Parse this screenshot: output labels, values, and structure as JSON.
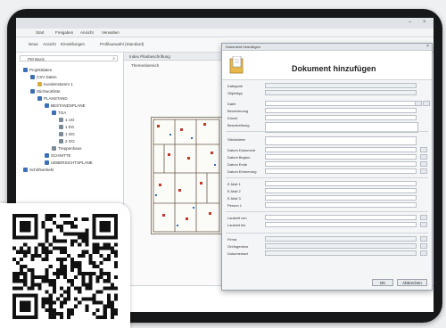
{
  "window": {
    "title": ""
  },
  "menu": {
    "items": [
      "Start",
      "Freigaben",
      "Ansicht",
      "Verwalten"
    ]
  },
  "toolbar": {
    "items": [
      "Neue",
      "Ansicht",
      "Einstellungen",
      "Profilauswahl (Standard)"
    ]
  },
  "tree": {
    "search_placeholder": "PM Basis",
    "items": [
      {
        "label": "Projektdaten",
        "level": 0,
        "color": "blue"
      },
      {
        "label": "CSV Daten",
        "level": 1,
        "color": "blue"
      },
      {
        "label": "Kundenstamm 1",
        "level": 2,
        "color": "yellow"
      },
      {
        "label": "Stichwortliste",
        "level": 1,
        "color": "blue"
      },
      {
        "label": "PLANSTAND",
        "level": 2,
        "color": "blue"
      },
      {
        "label": "BESTANDSPLANE",
        "level": 3,
        "color": "blue"
      },
      {
        "label": "TGA",
        "level": 4,
        "color": "blue"
      },
      {
        "label": "1 UG",
        "level": 5,
        "color": "gray"
      },
      {
        "label": "1 EG",
        "level": 5,
        "color": "gray"
      },
      {
        "label": "1 OG",
        "level": 5,
        "color": "gray"
      },
      {
        "label": "2 OG",
        "level": 5,
        "color": "gray"
      },
      {
        "label": "Treppenhaus",
        "level": 4,
        "color": "gray"
      },
      {
        "label": "SCHNITTE",
        "level": 3,
        "color": "blue"
      },
      {
        "label": "UEBERSICHTSPLANE",
        "level": 3,
        "color": "blue"
      },
      {
        "label": "Schriftverkehr",
        "level": 0,
        "color": "blue"
      }
    ]
  },
  "center": {
    "tab_label": "Index Planbeschriftung",
    "sub_label": "Themenbereich"
  },
  "dialog": {
    "window_title": "Dokument hinzufügen",
    "heading": "Dokument hinzufügen",
    "fields": [
      {
        "label": "Kategorie",
        "value": ""
      },
      {
        "label": "Objekttyp",
        "value": ""
      },
      {
        "label": "Datei",
        "value": ""
      },
      {
        "label": "Bezeichnung",
        "value": ""
      },
      {
        "label": "Kürzel",
        "value": ""
      },
      {
        "label": "Beschreibung",
        "value": ""
      },
      {
        "label": "Stichwörter",
        "value": ""
      },
      {
        "label": "Datum Dokument",
        "value": ""
      },
      {
        "label": "Datum Beginn",
        "value": ""
      },
      {
        "label": "Datum Ende",
        "value": ""
      },
      {
        "label": "Datum Erinnerung",
        "value": ""
      },
      {
        "label": "E-Mail 1",
        "value": ""
      },
      {
        "label": "E-Mail 2",
        "value": ""
      },
      {
        "label": "E-Mail 3",
        "value": ""
      },
      {
        "label": "Person 1",
        "value": ""
      },
      {
        "label": "Laufzeit von",
        "value": ""
      },
      {
        "label": "Laufzeit bis",
        "value": ""
      },
      {
        "label": "Firma",
        "value": ""
      },
      {
        "label": "Ort/Ingenieur",
        "value": ""
      },
      {
        "label": "Dokumentart",
        "value": ""
      }
    ],
    "ok_label": "OK",
    "cancel_label": "Abbrechen"
  },
  "bottomlist": {
    "rows": [
      "",
      ""
    ]
  }
}
